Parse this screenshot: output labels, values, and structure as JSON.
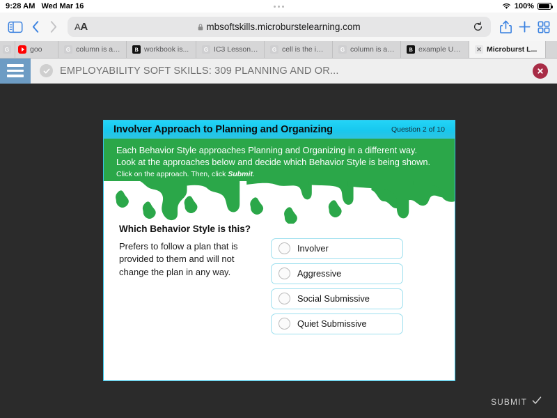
{
  "status_bar": {
    "time": "9:28 AM",
    "date": "Wed Mar 16",
    "battery_percent": "100%",
    "wifi_icon": "wifi-icon",
    "battery_icon": "battery-full-icon",
    "center_dots_icon": "ellipsis-icon"
  },
  "browser": {
    "sidebar_icon": "sidebar-toggle-icon",
    "back_icon": "chevron-left-icon",
    "forward_icon": "chevron-right-icon",
    "text_size_label": "A",
    "text_size_label_big": "A",
    "url": "mbsoftskills.microburstelearning.com",
    "lock_icon": "lock-icon",
    "reload_icon": "reload-icon",
    "share_icon": "share-icon",
    "new_tab_icon": "plus-icon",
    "show_tabs_icon": "tab-overview-icon",
    "tabs": [
      {
        "label": "",
        "favicon": "g",
        "active": false,
        "clipped": true
      },
      {
        "label": "goo",
        "favicon": "yt",
        "active": false,
        "clipped": true
      },
      {
        "label": "column is a v...",
        "favicon": "g",
        "active": false,
        "clipped": false
      },
      {
        "label": "workbook is...",
        "favicon": "blk",
        "active": false,
        "clipped": false
      },
      {
        "label": "IC3 Lesson 1...",
        "favicon": "g",
        "active": false,
        "clipped": false
      },
      {
        "label": "cell is the int...",
        "favicon": "g",
        "active": false,
        "clipped": false
      },
      {
        "label": "column is a v...",
        "favicon": "g",
        "active": false,
        "clipped": false
      },
      {
        "label": "example UR...",
        "favicon": "blk",
        "active": false,
        "clipped": false
      },
      {
        "label": "Microburst L...",
        "favicon": "x",
        "active": true,
        "clipped": false
      }
    ]
  },
  "app_header": {
    "menu_icon": "hamburger-menu-icon",
    "status_icon": "check-circle-icon",
    "title": "EMPLOYABILITY SOFT SKILLS: 309 PLANNING AND OR...",
    "close_icon": "close-circle-icon",
    "menu_color": "#6d9cc4",
    "close_color": "#a82c46"
  },
  "slide": {
    "header_title": "Involver Approach to Planning and Organizing",
    "question_counter": "Question 2 of 10",
    "header_color": "#18c8ee",
    "instruction_color": "#2ba749",
    "instructions": {
      "line1": "Each Behavior Style approaches Planning and Organizing in a different way.",
      "line2": "Look at the approaches below and decide which Behavior Style is being shown.",
      "line3_before": "Click on the approach. Then, click ",
      "line3_emphasis": "Submit",
      "line3_after": "."
    },
    "question_title": "Which Behavior Style is this?",
    "question_description": "Prefers to follow a plan that is provided to them and will not change the plan in any way.",
    "options": [
      {
        "label": "Involver",
        "selected": false
      },
      {
        "label": "Aggressive",
        "selected": false
      },
      {
        "label": "Social Submissive",
        "selected": false
      },
      {
        "label": "Quiet Submissive",
        "selected": false
      }
    ]
  },
  "footer": {
    "submit_label": "SUBMIT",
    "submit_check_icon": "check-icon"
  }
}
